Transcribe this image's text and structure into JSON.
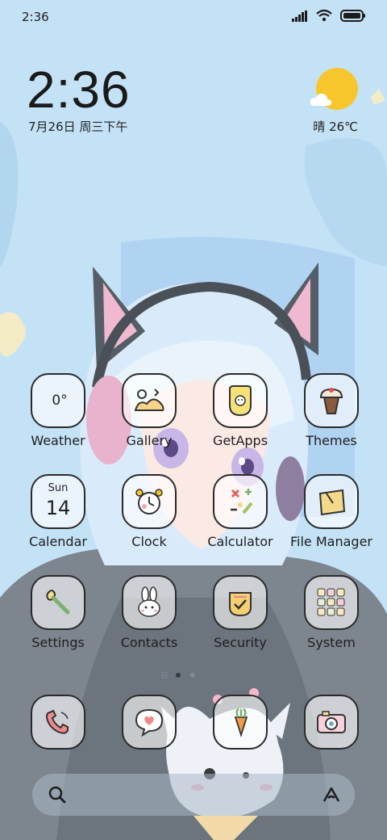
{
  "status_bar": {
    "time": "2:36"
  },
  "clock": {
    "time": "2:36",
    "date": "7月26日 周三下午"
  },
  "weather": {
    "condition_temp": "晴 26℃"
  },
  "apps": [
    {
      "label": "Weather"
    },
    {
      "label": "Gallery"
    },
    {
      "label": "GetApps"
    },
    {
      "label": "Themes"
    },
    {
      "label": "Calendar"
    },
    {
      "label": "Clock"
    },
    {
      "label": "Calculator"
    },
    {
      "label": "File Manager"
    },
    {
      "label": "Settings"
    },
    {
      "label": "Contacts"
    },
    {
      "label": "Security"
    },
    {
      "label": "System"
    }
  ],
  "weather_app": {
    "temp": "0°"
  },
  "calendar_app": {
    "day": "Sun",
    "date": "14"
  },
  "dock": [
    {
      "icon": "phone-icon"
    },
    {
      "icon": "messages-icon"
    },
    {
      "icon": "browser-icon"
    },
    {
      "icon": "camera-icon"
    }
  ],
  "page_indicator": {
    "pages": 2,
    "active": 1
  },
  "colors": {
    "background": "#c4e2f6",
    "weather_sun": "#f7c52c",
    "icon_border": "#2a2a2a"
  }
}
